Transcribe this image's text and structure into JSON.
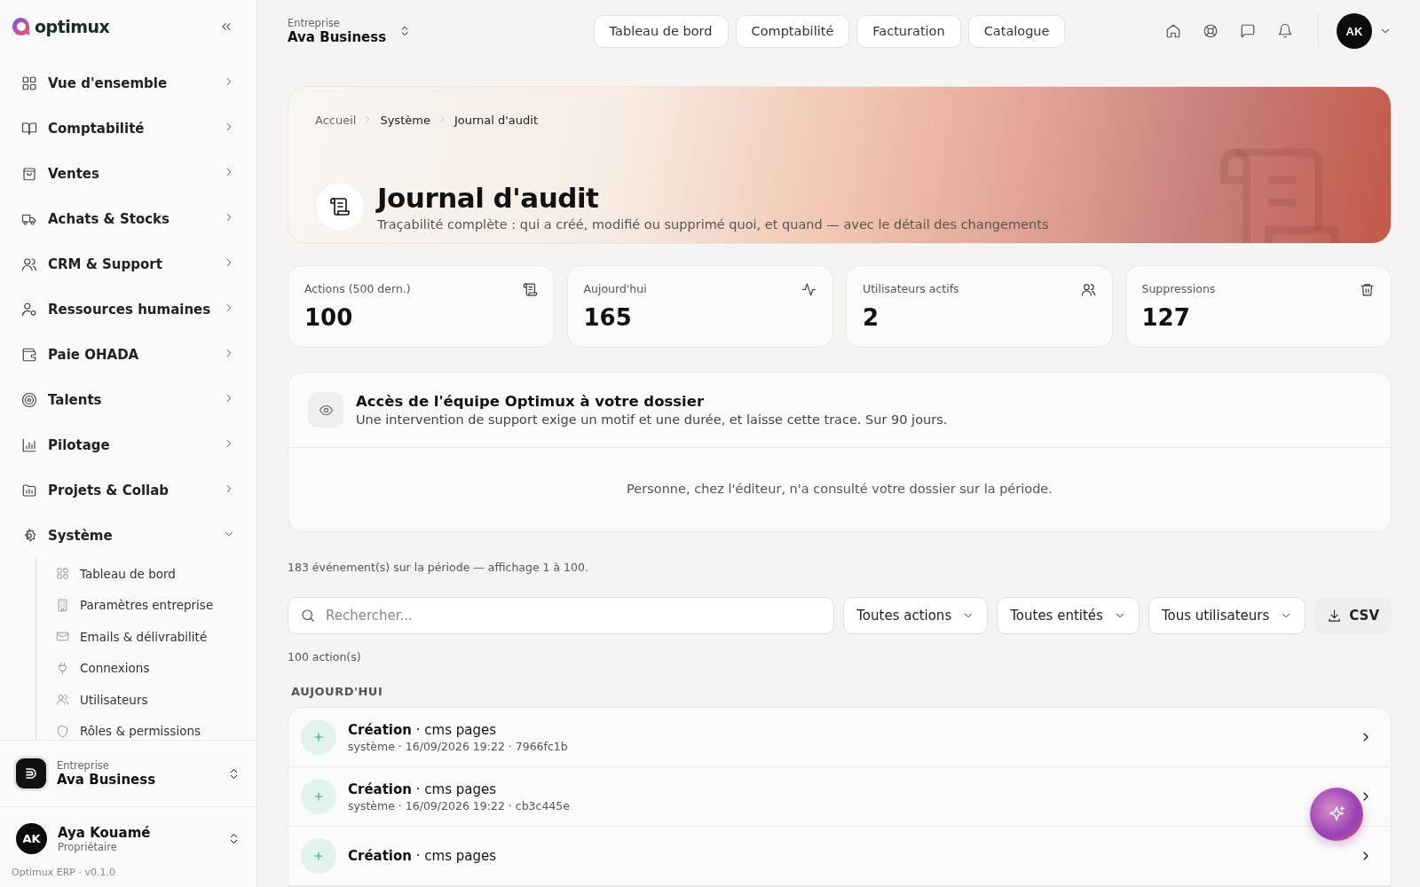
{
  "brand": {
    "name": "optimux"
  },
  "sidebar": {
    "items": [
      {
        "label": "Vue d'ensemble",
        "expanded": false
      },
      {
        "label": "Comptabilité",
        "expanded": false
      },
      {
        "label": "Ventes",
        "expanded": false
      },
      {
        "label": "Achats & Stocks",
        "expanded": false
      },
      {
        "label": "CRM & Support",
        "expanded": false
      },
      {
        "label": "Ressources humaines",
        "expanded": false
      },
      {
        "label": "Paie OHADA",
        "expanded": false
      },
      {
        "label": "Talents",
        "expanded": false
      },
      {
        "label": "Pilotage",
        "expanded": false
      },
      {
        "label": "Projets & Collab",
        "expanded": false
      },
      {
        "label": "Système",
        "expanded": true,
        "children": [
          {
            "label": "Tableau de bord"
          },
          {
            "label": "Paramètres entreprise"
          },
          {
            "label": "Emails & délivrabilité"
          },
          {
            "label": "Connexions"
          },
          {
            "label": "Utilisateurs"
          },
          {
            "label": "Rôles & permissions"
          }
        ]
      }
    ],
    "company": {
      "label": "Entreprise",
      "name": "Ava Business"
    },
    "user": {
      "initials": "AK",
      "name": "Aya Kouamé",
      "role": "Propriétaire"
    },
    "footer": "Optimux ERP · v0.1.0"
  },
  "topbar": {
    "company": {
      "label": "Entreprise",
      "name": "Ava Business"
    },
    "quick_links": [
      "Tableau de bord",
      "Comptabilité",
      "Facturation",
      "Catalogue"
    ],
    "avatar": "AK"
  },
  "hero": {
    "breadcrumb": [
      "Accueil",
      "Système",
      "Journal d'audit"
    ],
    "title": "Journal d'audit",
    "subtitle": "Traçabilité complète : qui a créé, modifié ou supprimé quoi, et quand — avec le détail des changements"
  },
  "stats": [
    {
      "label": "Actions (500 dern.)",
      "value": "100"
    },
    {
      "label": "Aujourd'hui",
      "value": "165"
    },
    {
      "label": "Utilisateurs actifs",
      "value": "2"
    },
    {
      "label": "Suppressions",
      "value": "127"
    }
  ],
  "access": {
    "title": "Accès de l'équipe Optimux à votre dossier",
    "subtitle": "Une intervention de support exige un motif et une durée, et laisse cette trace. Sur 90 jours.",
    "empty_message": "Personne, chez l'éditeur, n'a consulté votre dossier sur la période."
  },
  "summary": "183 événement(s) sur la période — affichage 1 à 100.",
  "search": {
    "placeholder": "Rechercher..."
  },
  "filters": [
    "Toutes actions",
    "Toutes entités",
    "Tous utilisateurs"
  ],
  "export": "CSV",
  "count": "100 action(s)",
  "groups": [
    {
      "label": "AUJOURD'HUI",
      "events": [
        {
          "kind": "create",
          "title": "**Création** · cms pages",
          "meta": "système · 16/09/2026 19:22 · 7966fc1b"
        },
        {
          "kind": "create",
          "title": "**Création** · cms pages",
          "meta": "système · 16/09/2026 19:22 · cb3c445e"
        },
        {
          "kind": "create",
          "title": "**Création** · cms pages"
        }
      ]
    }
  ]
}
